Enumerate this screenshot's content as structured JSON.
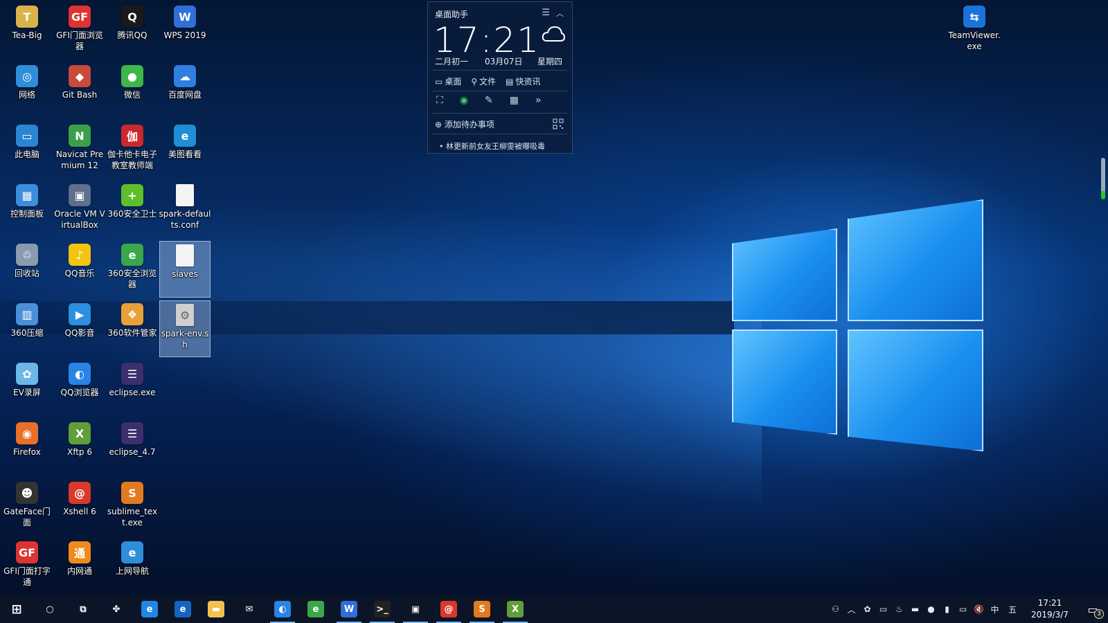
{
  "desktop": {
    "icons": [
      {
        "label": "Tea-Big",
        "glyph": "T",
        "color": "#d9b34a",
        "icon": "tea-icon"
      },
      {
        "label": "GFI门面浏览器",
        "glyph": "GF",
        "color": "#d33",
        "icon": "gf-browser-icon"
      },
      {
        "label": "腾讯QQ",
        "glyph": "Q",
        "color": "#1a1a1a",
        "icon": "qq-penguin-icon"
      },
      {
        "label": "WPS 2019",
        "glyph": "W",
        "color": "#2e6fd8",
        "icon": "wps-icon"
      },
      {
        "label": "网络",
        "glyph": "◎",
        "color": "#2f8ed8",
        "icon": "network-icon"
      },
      {
        "label": "Git Bash",
        "glyph": "◆",
        "color": "#c84a3a",
        "icon": "git-bash-icon"
      },
      {
        "label": "微信",
        "glyph": "●",
        "color": "#3db64a",
        "icon": "wechat-icon"
      },
      {
        "label": "百度网盘",
        "glyph": "☁",
        "color": "#2f7fe0",
        "icon": "baidu-netdisk-icon"
      },
      {
        "label": "此电脑",
        "glyph": "▭",
        "color": "#2b86d6",
        "icon": "this-pc-icon"
      },
      {
        "label": "Navicat Premium 12",
        "glyph": "N",
        "color": "#3aa04a",
        "icon": "navicat-icon"
      },
      {
        "label": "伽卡他卡电子教室教师端",
        "glyph": "伽",
        "color": "#c9282d",
        "icon": "jiajia-classroom-icon"
      },
      {
        "label": "美图看看",
        "glyph": "e",
        "color": "#1e8fd4",
        "icon": "meitu-viewer-icon"
      },
      {
        "label": "控制面板",
        "glyph": "▦",
        "color": "#3c8edc",
        "icon": "control-panel-icon"
      },
      {
        "label": "Oracle VM VirtualBox",
        "glyph": "▣",
        "color": "#5f6f8c",
        "icon": "virtualbox-icon"
      },
      {
        "label": "360安全卫士",
        "glyph": "+",
        "color": "#5fbf2a",
        "icon": "360-guard-icon"
      },
      {
        "label": "spark-defaults.conf",
        "glyph": "",
        "color": "#f4f4f4",
        "icon": "file-icon"
      },
      {
        "label": "回收站",
        "glyph": "♲",
        "color": "#8a9bb0",
        "icon": "recycle-bin-icon"
      },
      {
        "label": "QQ音乐",
        "glyph": "♪",
        "color": "#f1c40f",
        "icon": "qq-music-icon"
      },
      {
        "label": "360安全浏览器",
        "glyph": "e",
        "color": "#3aa84a",
        "icon": "360-browser-icon"
      },
      {
        "label": "slaves",
        "glyph": "",
        "color": "#f4f4f4",
        "icon": "file-icon"
      },
      {
        "label": "360压缩",
        "glyph": "▥",
        "color": "#4a90d8",
        "icon": "360-zip-icon"
      },
      {
        "label": "QQ影音",
        "glyph": "▶",
        "color": "#2d8fe0",
        "icon": "qq-player-icon"
      },
      {
        "label": "360软件管家",
        "glyph": "❖",
        "color": "#e8a13a",
        "icon": "360-software-icon"
      },
      {
        "label": "spark-env.sh",
        "glyph": "⚙",
        "color": "#cfcfcf",
        "icon": "script-file-icon"
      },
      {
        "label": "EV录屏",
        "glyph": "✿",
        "color": "#6bb7e8",
        "icon": "ev-recorder-icon"
      },
      {
        "label": "QQ浏览器",
        "glyph": "◐",
        "color": "#2a83e6",
        "icon": "qq-browser-icon"
      },
      {
        "label": "eclipse.exe",
        "glyph": "☰",
        "color": "#3c2f6e",
        "icon": "eclipse-icon"
      },
      {
        "label": "Firefox",
        "glyph": "◉",
        "color": "#e8702a",
        "icon": "firefox-icon"
      },
      {
        "label": "Xftp 6",
        "glyph": "X",
        "color": "#5f9e3a",
        "icon": "xftp-icon"
      },
      {
        "label": "eclipse_4.7",
        "glyph": "☰",
        "color": "#3c2f6e",
        "icon": "eclipse-icon"
      },
      {
        "label": "GateFace门面",
        "glyph": "☻",
        "color": "#333",
        "icon": "gateface-icon"
      },
      {
        "label": "Xshell 6",
        "glyph": "@",
        "color": "#d8392b",
        "icon": "xshell-icon"
      },
      {
        "label": "sublime_text.exe",
        "glyph": "S",
        "color": "#e27a1f",
        "icon": "sublime-icon"
      },
      {
        "label": "GFI门面打字通",
        "glyph": "GF",
        "color": "#d33",
        "icon": "gf-typing-icon"
      },
      {
        "label": "内网通",
        "glyph": "通",
        "color": "#f08a1c",
        "icon": "intranet-icon"
      },
      {
        "label": "上网导航",
        "glyph": "e",
        "color": "#2d8fd8",
        "icon": "web-nav-icon"
      },
      {
        "label": "TeamViewer.exe",
        "glyph": "⇆",
        "color": "#1a73d9",
        "icon": "teamviewer-icon"
      }
    ]
  },
  "widget": {
    "title": "桌面助手",
    "menu_icon": "hamburger-icon",
    "time": "17:21",
    "lunar": "二月初一",
    "date": "03月07日",
    "weekday": "星期四",
    "tabs": [
      "桌面",
      "文件",
      "快资讯"
    ],
    "add_todo": "添加待办事项",
    "news": "林更新前女友王柳雯被曝吸毒"
  },
  "taskbar": {
    "apps": [
      {
        "name": "start-button",
        "glyph": "⊞",
        "color": "transparent"
      },
      {
        "name": "cortana-search-button",
        "glyph": "○",
        "color": "transparent"
      },
      {
        "name": "task-view-button",
        "glyph": "⧉",
        "color": "transparent"
      },
      {
        "name": "taskbar-app-scatter",
        "glyph": "✤",
        "color": "transparent"
      },
      {
        "name": "taskbar-app-ie",
        "glyph": "e",
        "color": "#1e88e5"
      },
      {
        "name": "taskbar-app-edge",
        "glyph": "e",
        "color": "#1565c0"
      },
      {
        "name": "taskbar-app-explorer",
        "glyph": "▬",
        "color": "#f2c14e"
      },
      {
        "name": "taskbar-app-mail",
        "glyph": "✉",
        "color": "transparent"
      },
      {
        "name": "taskbar-app-qq-browser",
        "glyph": "◐",
        "color": "#2a83e6"
      },
      {
        "name": "taskbar-app-360-browser",
        "glyph": "e",
        "color": "#3aa84a"
      },
      {
        "name": "taskbar-app-wps",
        "glyph": "W",
        "color": "#2e6fd8"
      },
      {
        "name": "taskbar-app-terminal",
        "glyph": ">_",
        "color": "#222"
      },
      {
        "name": "taskbar-app-virtualbox",
        "glyph": "▣",
        "color": "transparent"
      },
      {
        "name": "taskbar-app-xshell",
        "glyph": "@",
        "color": "#d8392b"
      },
      {
        "name": "taskbar-app-sublime",
        "glyph": "S",
        "color": "#e27a1f"
      },
      {
        "name": "taskbar-app-xftp",
        "glyph": "X",
        "color": "#5f9e3a"
      }
    ],
    "tray": [
      "people-icon",
      "chevron-up-icon",
      "flower-icon",
      "keyboard-icon",
      "tray-app-icon",
      "display-icon",
      "360-icon",
      "battery-icon",
      "network-icon",
      "volume-mute-icon"
    ],
    "ime": "中",
    "ime_mode": "五",
    "clock_time": "17:21",
    "clock_date": "2019/3/7",
    "notification_count": "3"
  }
}
